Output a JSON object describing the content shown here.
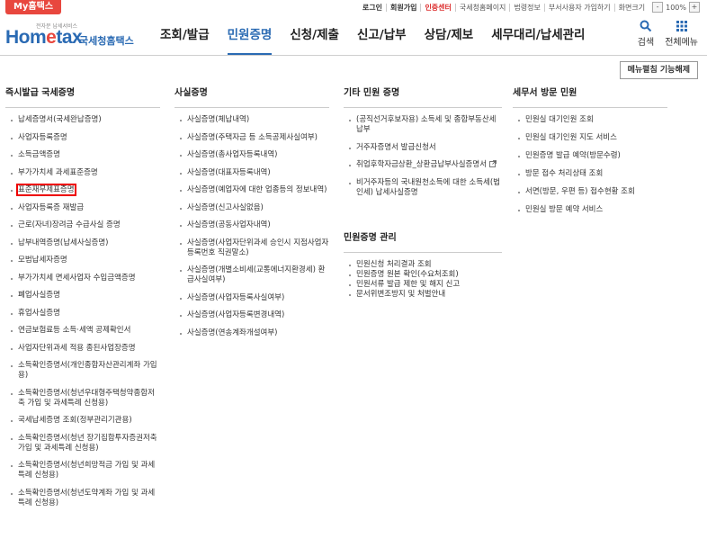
{
  "topbar": {
    "my_tax": "My홈택스",
    "utils": [
      "로그인",
      "회원가입",
      "인증센터",
      "국세청홈페이지",
      "법령정보",
      "부서사용자 가입하기",
      "화면크기"
    ],
    "zoom": "100%"
  },
  "logo": {
    "small": "전자문 납세서비스",
    "home_a": "Hom",
    "home_e": "e",
    "home_b": "tax",
    "kor": "국세청홈택스"
  },
  "nav": [
    "조회/발급",
    "민원증명",
    "신청/제출",
    "신고/납부",
    "상담/제보",
    "세무대리/납세관리"
  ],
  "tools": {
    "search": "검색",
    "menu": "전체메뉴"
  },
  "menu_off": "메뉴펼침 기능해제",
  "col1": {
    "title": "즉시발급 국세증명",
    "items": [
      "납세증명서(국세완납증명)",
      "사업자등록증명",
      "소득금액증명",
      "부가가치세 과세표준증명",
      "표준재무제표증명",
      "사업자등록증 재발급",
      "근로(자녀)장려금 수급사실 증명",
      "납부내역증명(납세사실증명)",
      "모범납세자증명",
      "부가가치세 면세사업자 수입금액증명",
      "폐업사실증명",
      "휴업사실증명",
      "연금보험료등 소득·세액 공제확인서",
      "사업자단위과세 적용 종된사업장증명",
      "소득확인증명서(개인종합자산관리계좌 가입용)",
      "소득확인증명서(청년우대형주택청약종합저축 가입 및 과세특례 신청용)",
      "국세납세증명 조회(정부관리기관용)",
      "소득확인증명서(청년 장기집합투자증권저축가입 및 과세특례 신청용)",
      "소득확인증명서(청년희망적금 가입 및 과세특례 신청용)",
      "소득확인증명서(청년도약계좌 가입 및 과세특례 신청용)"
    ],
    "highlight": "표준재무제표증명"
  },
  "col2": {
    "title": "사실증명",
    "items": [
      "사실증명(체납내역)",
      "사실증명(주택자금 등 소득공제사실여부)",
      "사실증명(총사업자등록내역)",
      "사실증명(대표자등록내역)",
      "사실증명(예업자에 대한 업종등의 정보내역)",
      "사실증명(신고사실없음)",
      "사실증명(공동사업자내역)",
      "사실증명(사업자단위과세 승인시 지점사업자등록번호 직권말소)",
      "사실증명(개별소비세(교통에너지환경세) 환급사실여부)",
      "사실증명(사업자등록사실여부)",
      "사실증명(사업자등록변경내역)",
      "사실증명(연송계좌개설여부)"
    ]
  },
  "col3": {
    "title": "기타 민원 증명",
    "items": [
      "(공직선거후보자용) 소득세 및 종합부동산세 납부",
      "거주자증명서 발급신청서",
      "취업후학자금상환_상환금납부사실증명서",
      "비거주자등의 국내원천소득에 대한 소득세(법인세) 납세사실증명"
    ],
    "sub_title": "민원증명 관리",
    "sub_items": [
      "민원신청 처리결과 조회",
      "민원증명 원본 확인(수요처조회)",
      "민원서류 발급 제한 및 해지 신고",
      "문서위변조방지 및 처벌안내"
    ]
  },
  "col4": {
    "title": "세무서 방문 민원",
    "items": [
      "민원실 대기인원 조회",
      "민원실 대기인원 지도 서비스",
      "민원증명 발급 예약(방문수령)",
      "방문 접수 처리상태 조회",
      "서면(방문, 우편 등) 접수현황 조회",
      "민원실 방문 예약 서비스"
    ]
  },
  "colors": {
    "brand": "#2a6ab3",
    "accent": "#e8473e",
    "highlight": "#e00000"
  }
}
